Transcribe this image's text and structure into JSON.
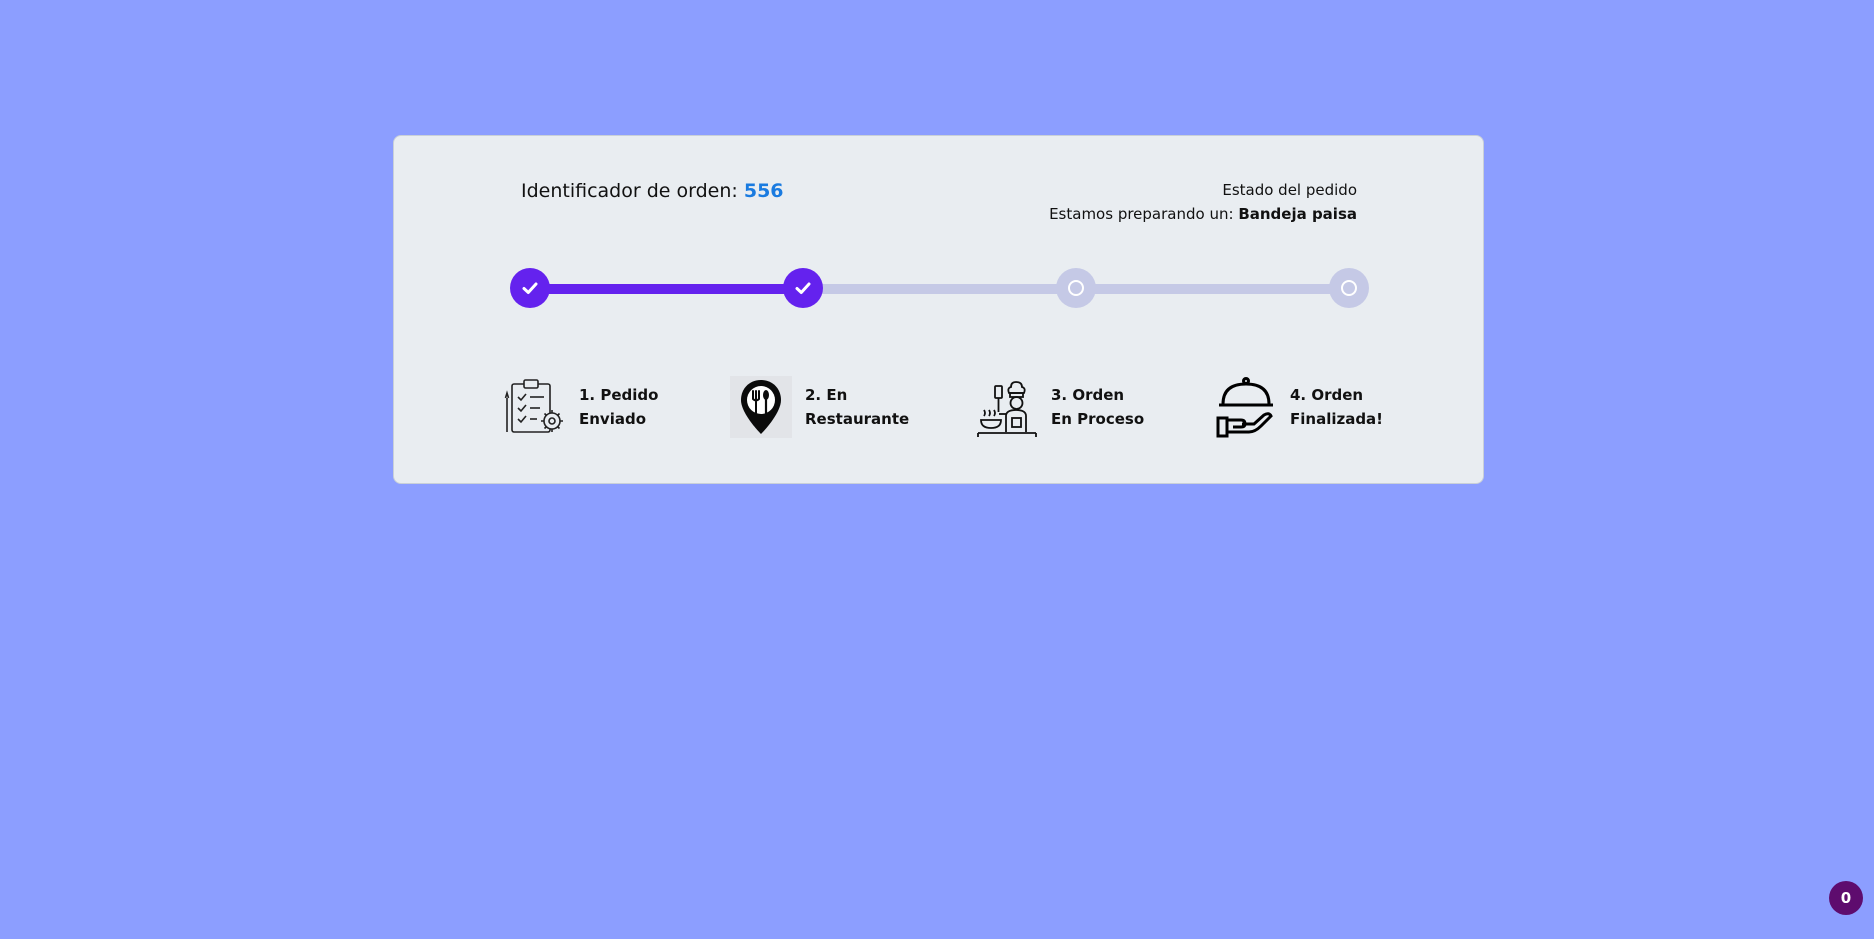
{
  "order": {
    "id_label": "Identificador de orden:",
    "id_value": "556"
  },
  "status": {
    "title": "Estado del pedido",
    "preparing_label": "Estamos preparando un:",
    "dish": "Bandeja paisa"
  },
  "progress": {
    "completed_steps": 2,
    "total_steps": 4,
    "fill_fraction": 0.333
  },
  "steps": [
    {
      "line1": "1. Pedido",
      "line2": "Enviado",
      "icon": "clipboard-gear-icon",
      "state": "done"
    },
    {
      "line1": "2. En",
      "line2": "Restaurante",
      "icon": "restaurant-pin-icon",
      "state": "done"
    },
    {
      "line1": "3. Orden",
      "line2": "En Proceso",
      "icon": "chef-cooking-icon",
      "state": "pending"
    },
    {
      "line1": "4. Orden",
      "line2": "Finalizada!",
      "icon": "serving-cloche-icon",
      "state": "pending"
    }
  ],
  "badge": {
    "count": "0"
  },
  "colors": {
    "background": "#8c9eff",
    "card": "#e9edf1",
    "active": "#6422ee",
    "inactive": "#c5c9e6",
    "order_number": "#1a7be0",
    "badge": "#5e0c6e"
  }
}
